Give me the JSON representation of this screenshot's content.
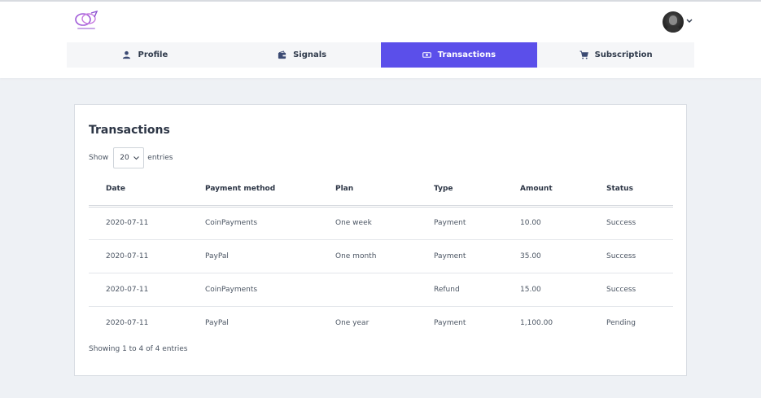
{
  "brand": {
    "logo_icon": "brand-logo-icon",
    "accent": "#a05bd8"
  },
  "user": {
    "avatar_icon": "avatar-icon"
  },
  "nav": {
    "active_color": "#5b4fea",
    "tabs": [
      {
        "label": "Profile",
        "icon": "user-icon",
        "active": false
      },
      {
        "label": "Signals",
        "icon": "wallet-icon",
        "active": false
      },
      {
        "label": "Transactions",
        "icon": "money-icon",
        "active": true
      },
      {
        "label": "Subscription",
        "icon": "cart-icon",
        "active": false
      }
    ]
  },
  "transactions": {
    "title": "Transactions",
    "show_label": "Show",
    "entries_label": "entries",
    "page_size": "20",
    "columns": [
      "Date",
      "Payment method",
      "Plan",
      "Type",
      "Amount",
      "Status"
    ],
    "rows": [
      [
        "2020-07-11",
        "CoinPayments",
        "One week",
        "Payment",
        "10.00",
        "Success"
      ],
      [
        "2020-07-11",
        "PayPal",
        "One month",
        "Payment",
        "35.00",
        "Success"
      ],
      [
        "2020-07-11",
        "CoinPayments",
        "",
        "Refund",
        "15.00",
        "Success"
      ],
      [
        "2020-07-11",
        "PayPal",
        "One year",
        "Payment",
        "1,100.00",
        "Pending"
      ]
    ],
    "info": "Showing 1 to 4 of 4 entries"
  }
}
